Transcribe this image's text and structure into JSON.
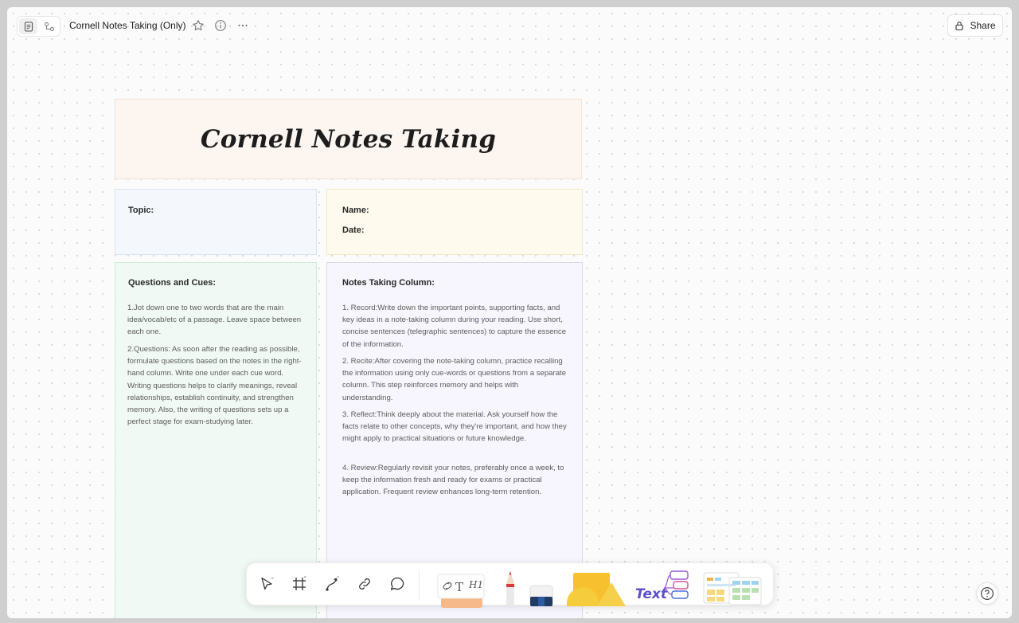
{
  "topbar": {
    "title": "Cornell Notes Taking (Only)",
    "share_label": "Share"
  },
  "template": {
    "title": "Cornell Notes Taking",
    "topic_label": "Topic:",
    "name_label": "Name:",
    "date_label": "Date:",
    "questions": {
      "heading": "Questions and Cues:",
      "items": [
        "1.Jot down one to two words that are the main idea/vocab/etc of a passage. Leave space between each one.",
        "2.Questions: As soon after the reading as possible, formulate questions based on the notes in the right-hand column. Write one under each cue word. Writing questions helps to clarify meanings, reveal relationships, establish continuity, and strengthen memory. Also, the writing of questions sets up a perfect stage for exam-studying later."
      ]
    },
    "notes": {
      "heading": "Notes Taking Column:",
      "items": [
        "1. Record:Write down the important points, supporting facts, and key ideas in a note-taking column during your reading. Use short, concise sentences (telegraphic sentences) to capture the essence of the information.",
        "2. Recite:After covering the note-taking column, practice recalling the information using only cue-words or questions from a separate column. This step reinforces memory and helps with understanding.",
        "3. Reflect:Think deeply about the material. Ask yourself how the facts relate to other concepts, why they're important, and how they might apply to practical situations or future knowledge.",
        "4. Review:Regularly revisit your notes, preferably once a week, to keep the information fresh and ready for exams or practical application. Frequent review enhances long-term retention."
      ]
    }
  },
  "toolbar": {
    "tools": [
      "pointer-icon",
      "frame-icon",
      "connector-icon",
      "link-icon",
      "comment-icon"
    ],
    "text_sticker_label": "Text",
    "note_card_heading": "H1"
  },
  "colors": {
    "header_bg": "#fdf5ef",
    "topic_bg": "#f4f8fd",
    "name_bg": "#fefaee",
    "questions_bg": "#f0f9f3",
    "notes_bg": "#f7f5fd"
  }
}
